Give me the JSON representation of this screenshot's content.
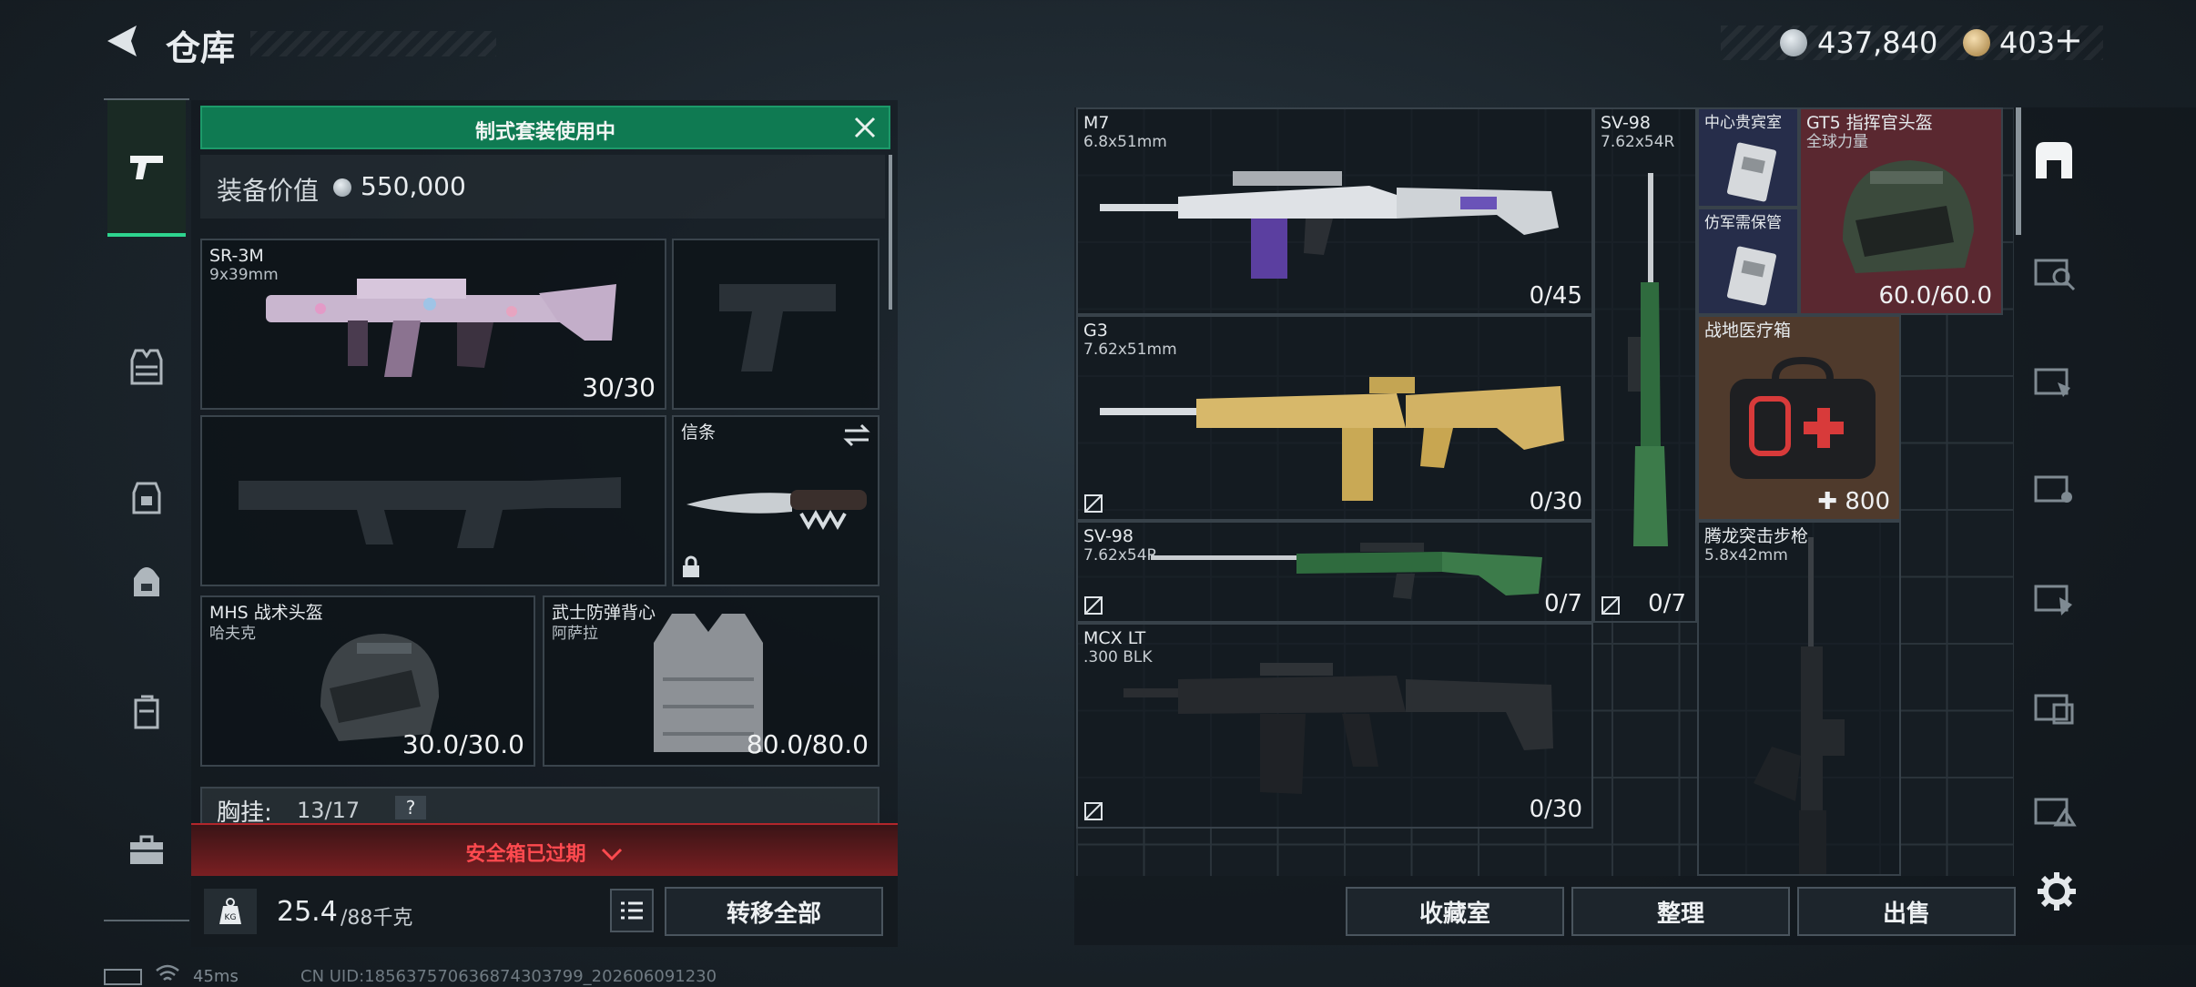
{
  "header": {
    "title": "仓库",
    "currency1": "437,840",
    "currency2": "403",
    "plus": "+"
  },
  "loadout": {
    "banner": "制式套装使用中",
    "value_label": "装备价值",
    "value": "550,000",
    "primary": {
      "name": "SR-3M",
      "sub": "9x39mm",
      "count": "30/30"
    },
    "melee": {
      "name": "信条"
    },
    "helmet": {
      "name": "MHS 战术头盔",
      "sub": "哈夫克",
      "count": "30.0/30.0"
    },
    "armor": {
      "name": "武士防弹背心",
      "sub": "阿萨拉",
      "count": "80.0/80.0"
    },
    "rig": {
      "label": "胸挂:",
      "value": "13/17",
      "help": "?"
    },
    "safebox": "安全箱已过期",
    "weight": "25.4",
    "weight_max": "/88千克",
    "kg": "KG",
    "transfer_all": "转移全部"
  },
  "storage": {
    "items": [
      {
        "name": "M7",
        "sub": "6.8x51mm",
        "count": "0/45"
      },
      {
        "name": "SV-98",
        "sub": "7.62x54R",
        "count": "0/7"
      },
      {
        "name": "中心贵宾室",
        "sub": ""
      },
      {
        "name": "GT5 指挥官头盔",
        "sub": "全球力量",
        "count": "60.0/60.0"
      },
      {
        "name": "仿军需保管",
        "sub": ""
      },
      {
        "name": "G3",
        "sub": "7.62x51mm",
        "count": "0/30"
      },
      {
        "name": "战地医疗箱",
        "sub": "",
        "count": "800"
      },
      {
        "name": "SV-98",
        "sub": "7.62x54R",
        "count": "0/7"
      },
      {
        "name": "腾龙突击步枪",
        "sub": "5.8x42mm"
      },
      {
        "name": "MCX LT",
        "sub": ".300 BLK",
        "count": "0/30"
      }
    ],
    "buttons": {
      "collection": "收藏室",
      "sort": "整理",
      "sell": "出售"
    }
  },
  "status_bar": {
    "ping": "45ms",
    "uid": "CN UID:18563757063687430379​9_202606091230"
  },
  "colors": {
    "green": "#0f7a52",
    "red_banner": "#7a1f22",
    "helmet_bg": "#5a2830",
    "medkit_bg": "#4f3a2c"
  }
}
